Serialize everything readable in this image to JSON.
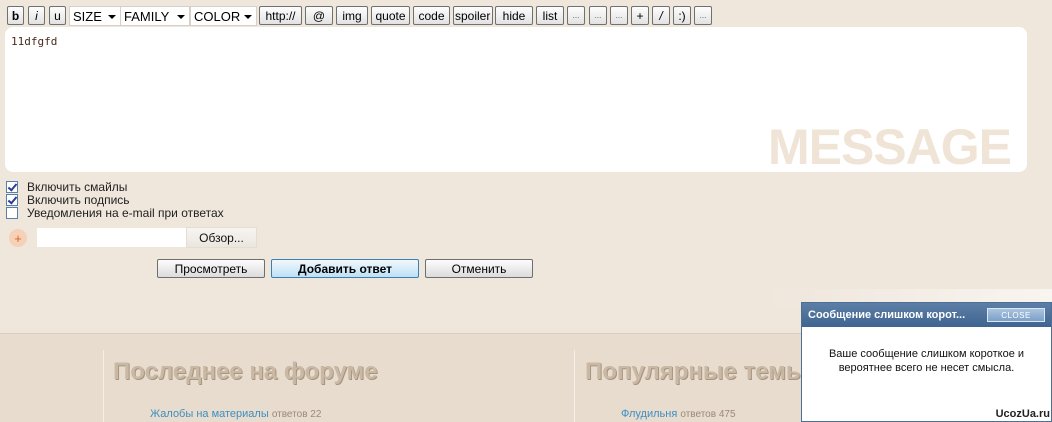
{
  "toolbar": {
    "bold": "b",
    "italic": "i",
    "underline": "u",
    "size": "SIZE",
    "family": "FAMILY",
    "color": "COLOR",
    "url": "http://",
    "email": "@",
    "img": "img",
    "quote": "quote",
    "code": "code",
    "spoiler": "spoiler",
    "hide": "hide",
    "list": "list",
    "ext1": "...",
    "ext2": "...",
    "ext3": "...",
    "plus": "+",
    "slash": "/",
    "smile": ":)",
    "ext4": "..."
  },
  "editor": {
    "value": "11dfgfd",
    "watermark": "MESSAGE"
  },
  "options": [
    {
      "label": "Включить смайлы",
      "checked": true
    },
    {
      "label": "Включить подпись",
      "checked": true
    },
    {
      "label": "Уведомления на e-mail при ответах",
      "checked": false
    }
  ],
  "attach": {
    "plus": "+",
    "browse": "Обзор..."
  },
  "actions": {
    "preview": "Просмотреть",
    "submit": "Добавить ответ",
    "cancel": "Отменить"
  },
  "forum": {
    "latest_title": "Последнее на форуме",
    "popular_title": "Популярные темы",
    "latest_topic": {
      "title": "Жалобы на материалы",
      "count": "ответов 22"
    },
    "popular_topic": {
      "title": "Флудильня",
      "count": "ответов 475"
    }
  },
  "dialog": {
    "title": "Сообщение слишком корот...",
    "close": "CLOSE",
    "text": "Ваше сообщение слишком короткое и вероятнее всего не несет смысла."
  },
  "brand": "UcozUa.ru"
}
